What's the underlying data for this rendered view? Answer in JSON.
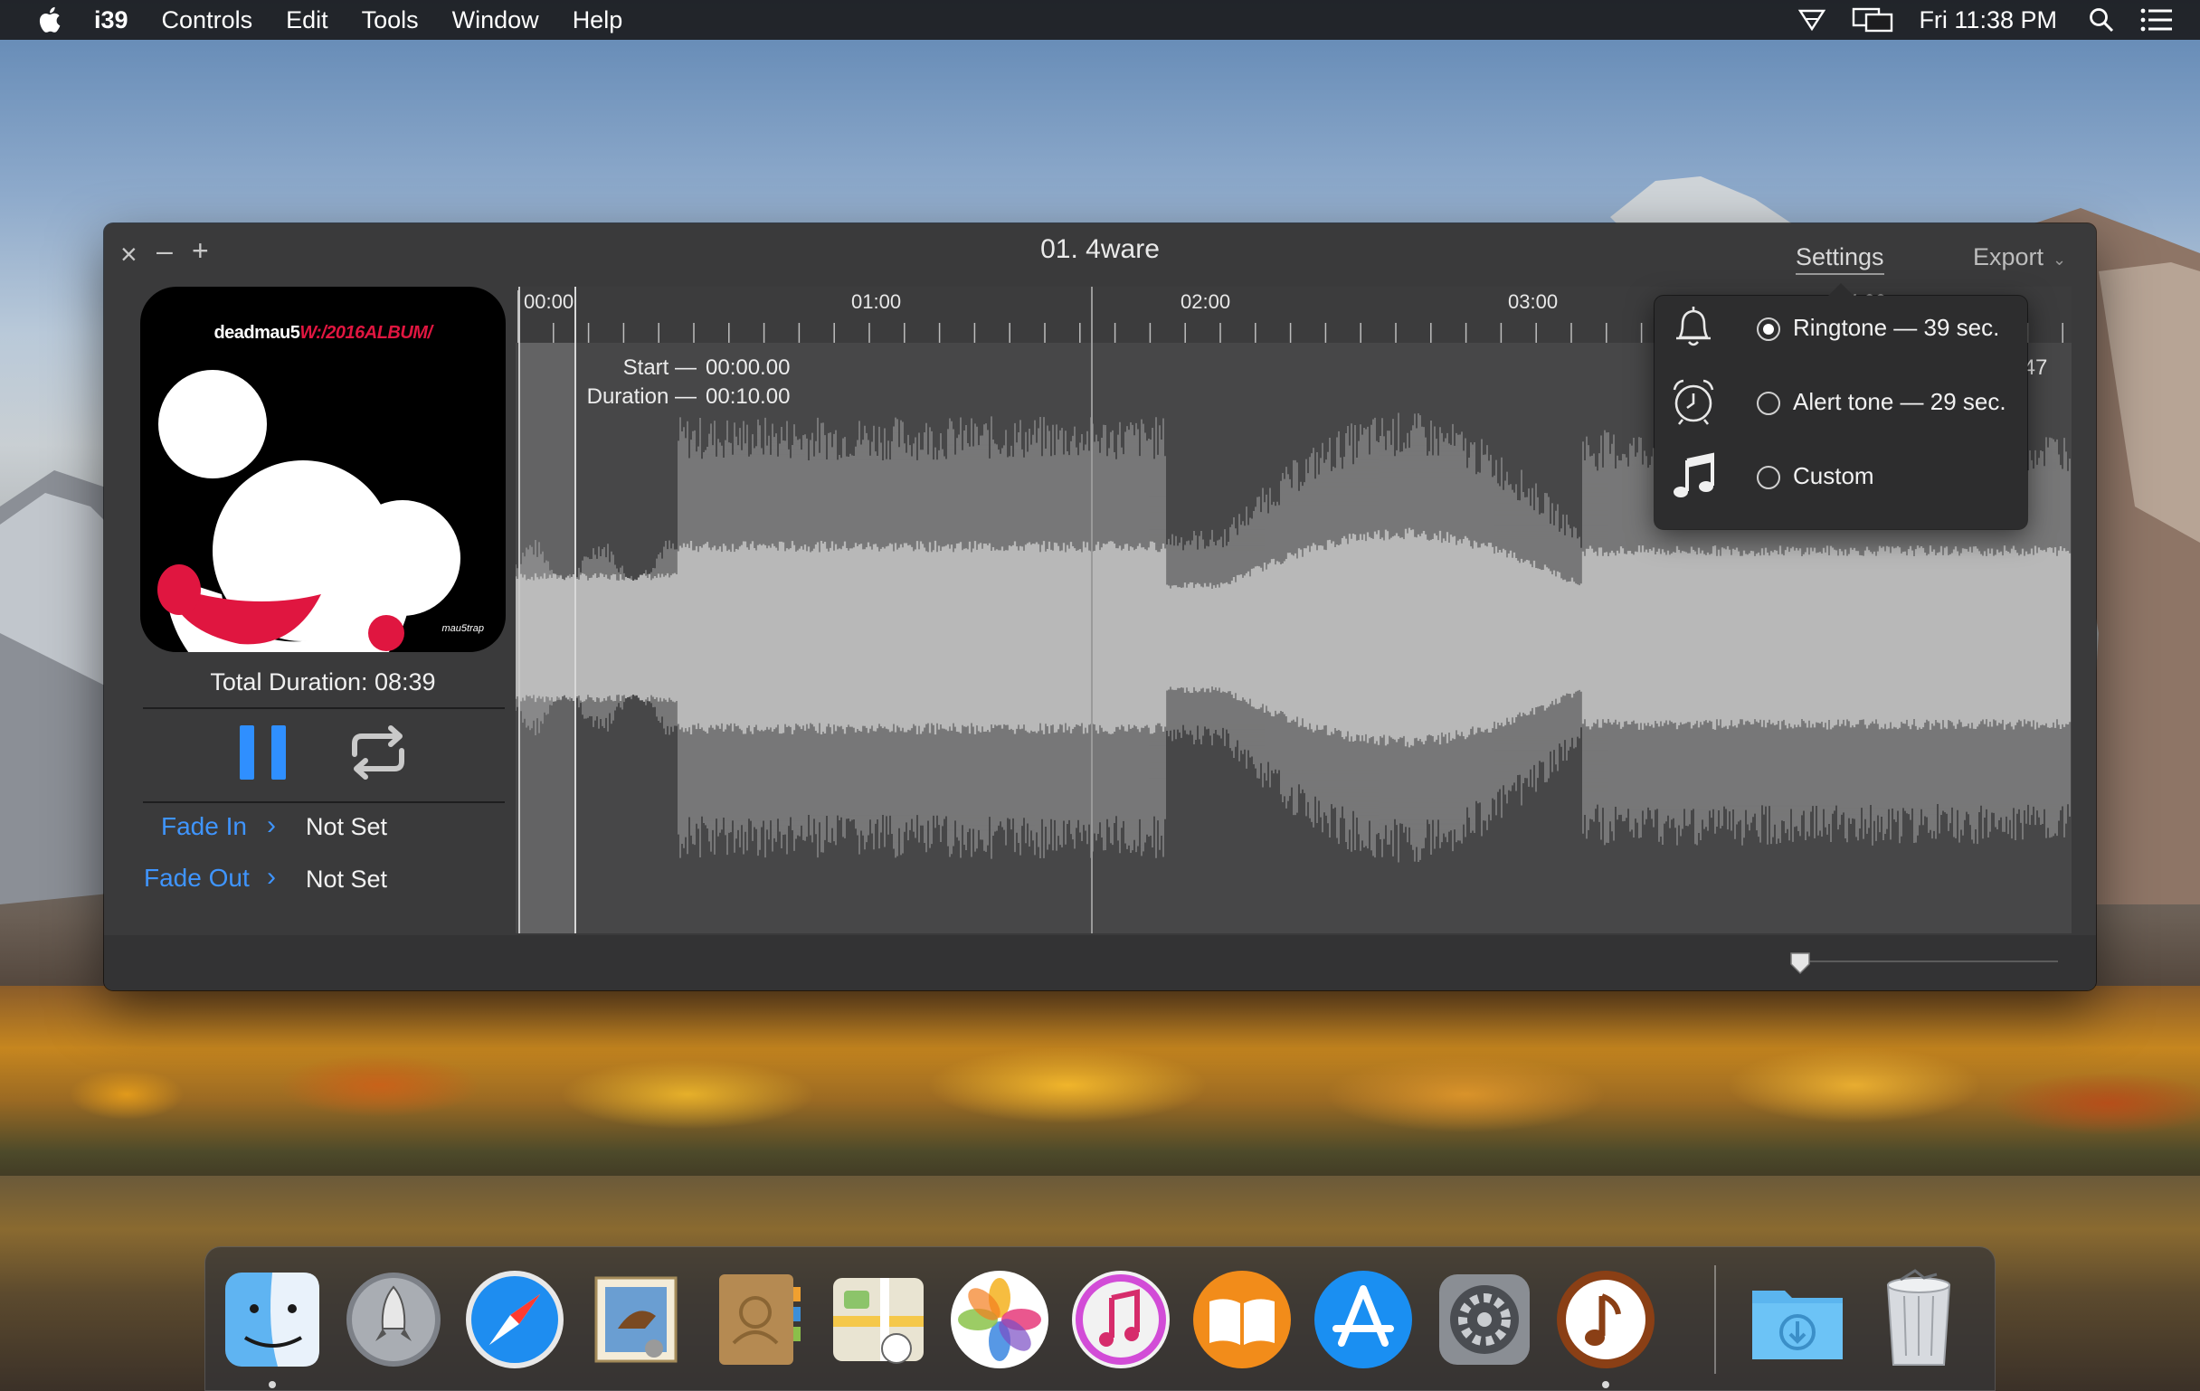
{
  "menubar": {
    "app_name": "i39",
    "items": [
      "Controls",
      "Edit",
      "Tools",
      "Window",
      "Help"
    ],
    "clock": "Fri 11:38 PM"
  },
  "window": {
    "title": "01. 4ware",
    "settings_label": "Settings",
    "export_label": "Export"
  },
  "album": {
    "title_prefix": "deadmau5",
    "title_suffix": "W:/2016ALBUM/",
    "label": "mau5trap"
  },
  "player": {
    "total_duration_label": "Total Duration: 08:39",
    "fade_in_label": "Fade In",
    "fade_in_value": "Not Set",
    "fade_out_label": "Fade Out",
    "fade_out_value": "Not Set"
  },
  "waveform": {
    "ruler_labels": [
      "00:00",
      "01:00",
      "02:00",
      "03:00",
      "04:00"
    ],
    "start_label": "Start —",
    "start_value": "00:00.00",
    "duration_label": "Duration —",
    "duration_value": "00:10.00",
    "partial_label": ".47"
  },
  "settings_popover": {
    "options": [
      {
        "label": "Ringtone — 39 sec.",
        "selected": true,
        "icon": "bell-icon"
      },
      {
        "label": "Alert tone — 29 sec.",
        "selected": false,
        "icon": "alarm-clock-icon"
      },
      {
        "label": "Custom",
        "selected": false,
        "icon": "music-note-icon"
      }
    ]
  },
  "dock": {
    "apps": [
      "finder-icon",
      "launchpad-icon",
      "safari-icon",
      "mail-icon",
      "contacts-icon",
      "maps-icon",
      "photos-icon",
      "itunes-icon",
      "ibooks-icon",
      "app-store-icon",
      "system-preferences-icon",
      "i39-icon",
      "downloads-folder-icon",
      "trash-icon"
    ]
  },
  "colors": {
    "accent": "#2f8fff",
    "album_red": "#e01640"
  }
}
